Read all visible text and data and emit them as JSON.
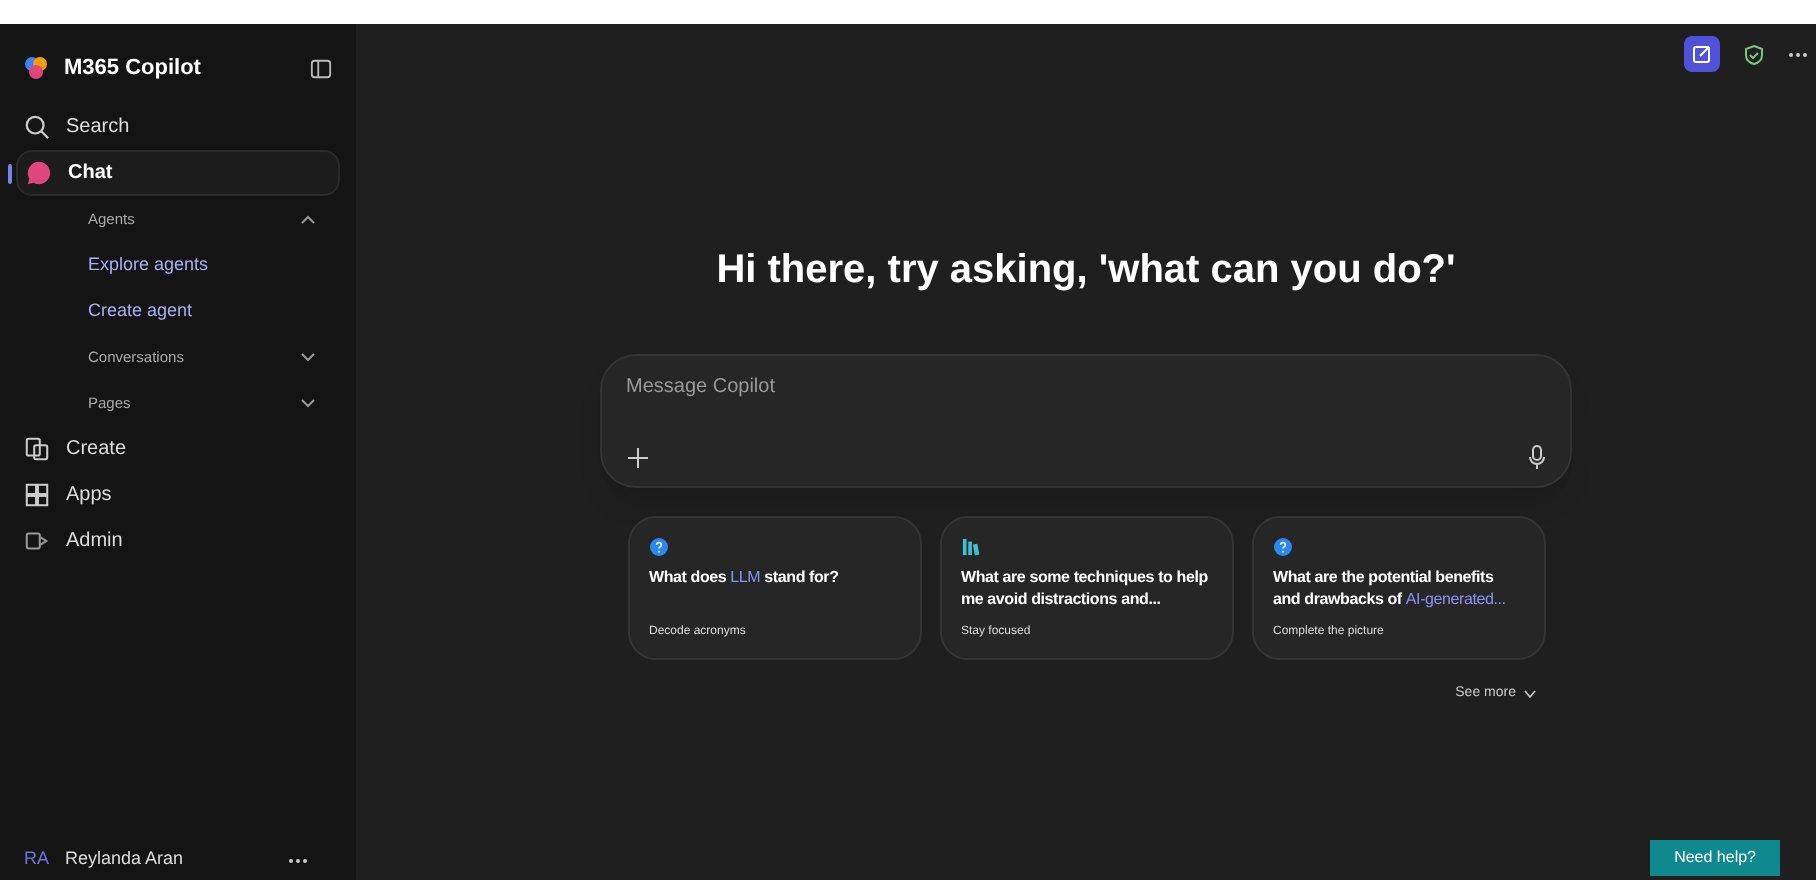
{
  "sidebar": {
    "app_title": "M365 Copilot",
    "nav": [
      {
        "kind": "item",
        "label": "Search",
        "selected": false
      },
      {
        "kind": "item",
        "label": "Chat",
        "selected": true
      },
      {
        "kind": "section",
        "label": "Agents",
        "expanded": true
      },
      {
        "kind": "link",
        "label": "Explore agents"
      },
      {
        "kind": "link",
        "label": "Create agent"
      },
      {
        "kind": "section",
        "label": "Conversations",
        "expanded": false
      },
      {
        "kind": "section",
        "label": "Pages",
        "expanded": false
      },
      {
        "kind": "item",
        "label": "Create",
        "selected": false
      },
      {
        "kind": "item",
        "label": "Apps",
        "selected": false
      },
      {
        "kind": "item",
        "label": "Admin",
        "selected": false
      }
    ],
    "user": {
      "initials": "RA",
      "name": "Reylanda Aran"
    }
  },
  "heading": "Hi there, try asking, 'what can you do?'",
  "composer": {
    "placeholder": "Message Copilot"
  },
  "prompts": [
    {
      "title": [
        {
          "text": "What does ",
          "highlight": false
        },
        {
          "text": "LLM",
          "highlight": true
        },
        {
          "text": " stand for?",
          "highlight": false
        }
      ],
      "caption": "Decode acronyms"
    },
    {
      "title": [
        {
          "text": "What are some techniques to help me avoid distractions and...",
          "highlight": false
        }
      ],
      "caption": "Stay focused"
    },
    {
      "title": [
        {
          "text": "What are the potential benefits and drawbacks of ",
          "highlight": false
        },
        {
          "text": "AI-generated...",
          "highlight": true
        }
      ],
      "caption": "Complete the picture"
    }
  ],
  "see_more": "See more",
  "help_button": "Need help?"
}
